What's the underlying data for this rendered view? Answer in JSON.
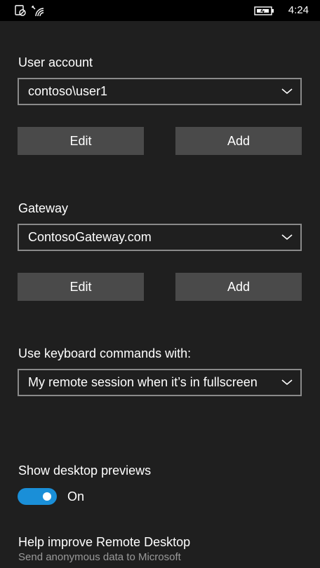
{
  "status_bar": {
    "time": "4:24",
    "icons": [
      "do-not-disturb-icon",
      "wifi-icon",
      "battery-charging-icon"
    ]
  },
  "user_account": {
    "label": "User account",
    "selected": "contoso\\user1",
    "edit_label": "Edit",
    "add_label": "Add"
  },
  "gateway": {
    "label": "Gateway",
    "selected": "ContosoGateway.com",
    "edit_label": "Edit",
    "add_label": "Add"
  },
  "keyboard": {
    "label": "Use keyboard commands with:",
    "selected": "My remote session when it’s in fullscreen"
  },
  "desktop_previews": {
    "label": "Show desktop previews",
    "state": "On",
    "enabled": true,
    "toggle_color": "#1a8fd8"
  },
  "help_improve": {
    "label": "Help improve Remote Desktop",
    "subtext": "Send anonymous data to Microsoft"
  }
}
